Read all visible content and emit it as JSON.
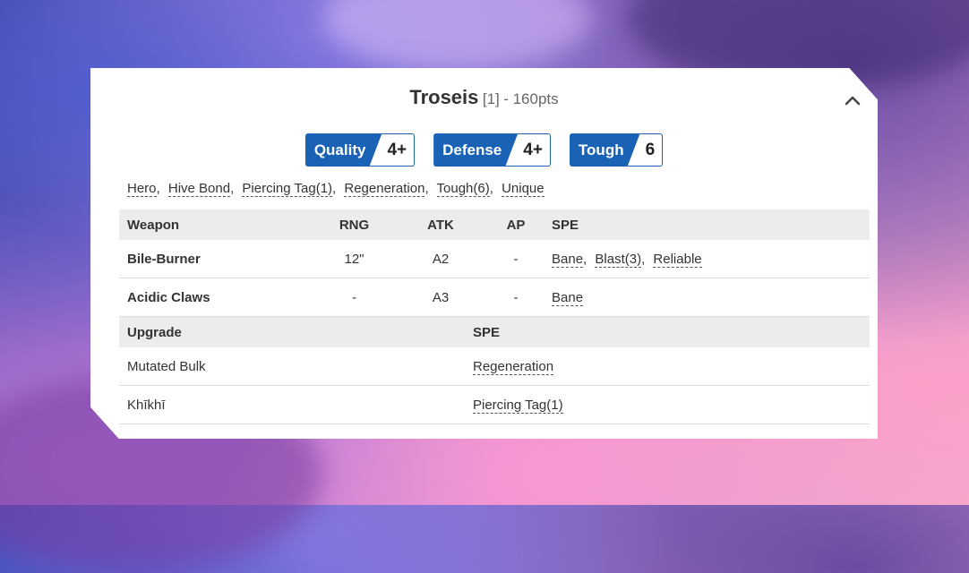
{
  "unit": {
    "name": "Troseis",
    "count": "[1]",
    "points": "- 160pts"
  },
  "stats": [
    {
      "label": "Quality",
      "value": "4+"
    },
    {
      "label": "Defense",
      "value": "4+"
    },
    {
      "label": "Tough",
      "value": "6"
    }
  ],
  "special_rules": [
    "Hero",
    "Hive Bond",
    "Piercing Tag(1)",
    "Regeneration",
    "Tough(6)",
    "Unique"
  ],
  "weapons_table": {
    "headers": {
      "weapon": "Weapon",
      "rng": "RNG",
      "atk": "ATK",
      "ap": "AP",
      "spe": "SPE"
    },
    "rows": [
      {
        "name": "Bile-Burner",
        "rng": "12\"",
        "atk": "A2",
        "ap": "-",
        "spe": [
          "Bane",
          "Blast(3)",
          "Reliable"
        ]
      },
      {
        "name": "Acidic Claws",
        "rng": "-",
        "atk": "A3",
        "ap": "-",
        "spe": [
          "Bane"
        ]
      }
    ]
  },
  "upgrades_table": {
    "headers": {
      "upgrade": "Upgrade",
      "spe": "SPE"
    },
    "rows": [
      {
        "name": "Mutated Bulk",
        "spe": [
          "Regeneration"
        ]
      },
      {
        "name": "Khīkhī",
        "spe": [
          "Piercing Tag(1)"
        ]
      }
    ]
  },
  "colors": {
    "accent": "#1a62b5",
    "header_bg": "#ececec"
  },
  "icons": {
    "collapse": "chevron-up-icon"
  }
}
